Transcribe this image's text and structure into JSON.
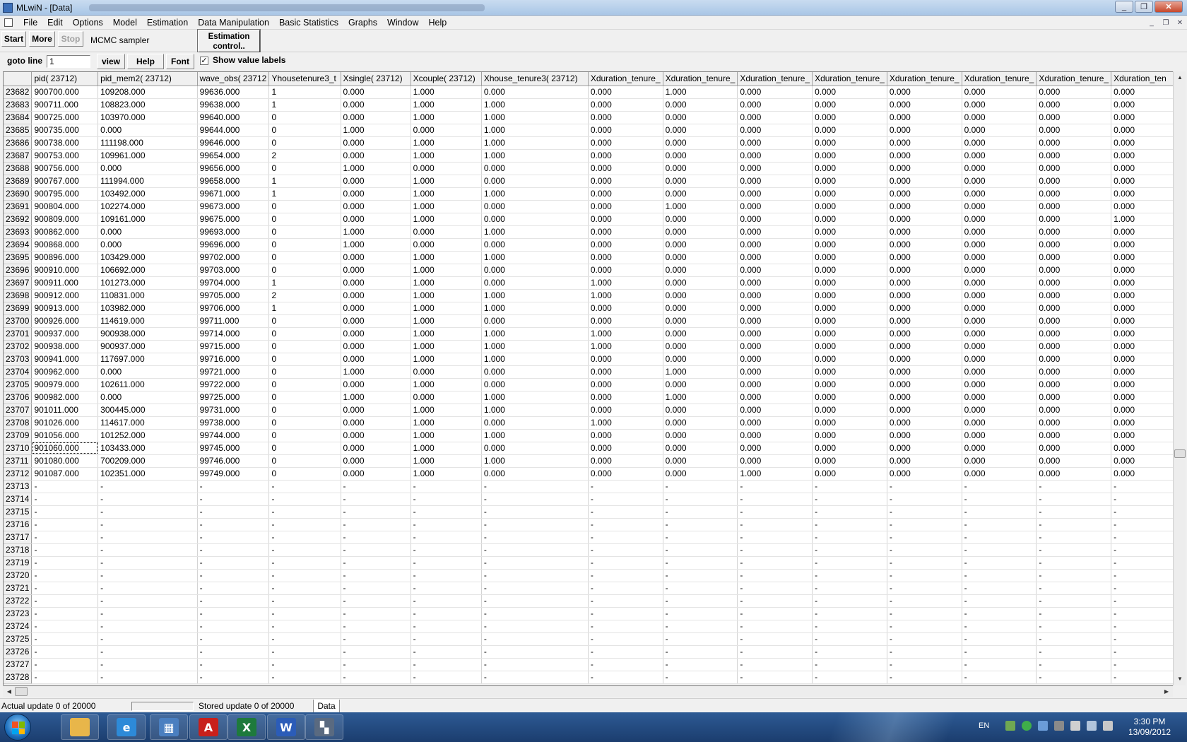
{
  "window": {
    "title": "MLwiN - [Data]",
    "controls": [
      "_",
      "❐",
      "✕"
    ]
  },
  "menu": [
    "File",
    "Edit",
    "Options",
    "Model",
    "Estimation",
    "Data Manipulation",
    "Basic Statistics",
    "Graphs",
    "Window",
    "Help"
  ],
  "toolbar": {
    "start": "Start",
    "more": "More",
    "stop": "Stop",
    "sampler_label": "MCMC sampler",
    "estimation_line1": "Estimation",
    "estimation_line2": "control.."
  },
  "data_controls": {
    "goto_label": "goto line",
    "goto_value": "1",
    "view": "view",
    "help": "Help",
    "font": "Font",
    "show_value_labels_checked": "✓",
    "show_value_labels": "Show value labels"
  },
  "grid": {
    "columns": [
      "pid( 23712)",
      "pid_mem2( 23712)",
      "wave_obs( 23712",
      "Yhousetenure3_t",
      "Xsingle( 23712)",
      "Xcouple( 23712)",
      "Xhouse_tenure3( 23712)",
      "Xduration_tenure_",
      "Xduration_tenure_",
      "Xduration_tenure_",
      "Xduration_tenure_",
      "Xduration_tenure_",
      "Xduration_tenure_",
      "Xduration_tenure_",
      "Xduration_ten"
    ],
    "rows": [
      [
        "23682",
        "900700.000",
        "109208.000",
        "99636.000",
        "1",
        "0.000",
        "1.000",
        "0.000",
        "0.000",
        "1.000",
        "0.000",
        "0.000",
        "0.000",
        "0.000",
        "0.000",
        "0.000"
      ],
      [
        "23683",
        "900711.000",
        "108823.000",
        "99638.000",
        "1",
        "0.000",
        "1.000",
        "1.000",
        "0.000",
        "0.000",
        "0.000",
        "0.000",
        "0.000",
        "0.000",
        "0.000",
        "0.000"
      ],
      [
        "23684",
        "900725.000",
        "103970.000",
        "99640.000",
        "0",
        "0.000",
        "1.000",
        "1.000",
        "0.000",
        "0.000",
        "0.000",
        "0.000",
        "0.000",
        "0.000",
        "0.000",
        "0.000"
      ],
      [
        "23685",
        "900735.000",
        "0.000",
        "99644.000",
        "0",
        "1.000",
        "0.000",
        "1.000",
        "0.000",
        "0.000",
        "0.000",
        "0.000",
        "0.000",
        "0.000",
        "0.000",
        "0.000"
      ],
      [
        "23686",
        "900738.000",
        "111198.000",
        "99646.000",
        "0",
        "0.000",
        "1.000",
        "1.000",
        "0.000",
        "0.000",
        "0.000",
        "0.000",
        "0.000",
        "0.000",
        "0.000",
        "0.000"
      ],
      [
        "23687",
        "900753.000",
        "109961.000",
        "99654.000",
        "2",
        "0.000",
        "1.000",
        "1.000",
        "0.000",
        "0.000",
        "0.000",
        "0.000",
        "0.000",
        "0.000",
        "0.000",
        "0.000"
      ],
      [
        "23688",
        "900756.000",
        "0.000",
        "99656.000",
        "0",
        "1.000",
        "0.000",
        "0.000",
        "0.000",
        "0.000",
        "0.000",
        "0.000",
        "0.000",
        "0.000",
        "0.000",
        "0.000"
      ],
      [
        "23689",
        "900767.000",
        "111994.000",
        "99658.000",
        "1",
        "0.000",
        "1.000",
        "0.000",
        "0.000",
        "0.000",
        "0.000",
        "0.000",
        "0.000",
        "0.000",
        "0.000",
        "0.000"
      ],
      [
        "23690",
        "900795.000",
        "103492.000",
        "99671.000",
        "1",
        "0.000",
        "1.000",
        "1.000",
        "0.000",
        "0.000",
        "0.000",
        "0.000",
        "0.000",
        "0.000",
        "0.000",
        "0.000"
      ],
      [
        "23691",
        "900804.000",
        "102274.000",
        "99673.000",
        "0",
        "0.000",
        "1.000",
        "0.000",
        "0.000",
        "1.000",
        "0.000",
        "0.000",
        "0.000",
        "0.000",
        "0.000",
        "0.000"
      ],
      [
        "23692",
        "900809.000",
        "109161.000",
        "99675.000",
        "0",
        "0.000",
        "1.000",
        "0.000",
        "0.000",
        "0.000",
        "0.000",
        "0.000",
        "0.000",
        "0.000",
        "0.000",
        "1.000"
      ],
      [
        "23693",
        "900862.000",
        "0.000",
        "99693.000",
        "0",
        "1.000",
        "0.000",
        "1.000",
        "0.000",
        "0.000",
        "0.000",
        "0.000",
        "0.000",
        "0.000",
        "0.000",
        "0.000"
      ],
      [
        "23694",
        "900868.000",
        "0.000",
        "99696.000",
        "0",
        "1.000",
        "0.000",
        "0.000",
        "0.000",
        "0.000",
        "0.000",
        "0.000",
        "0.000",
        "0.000",
        "0.000",
        "0.000"
      ],
      [
        "23695",
        "900896.000",
        "103429.000",
        "99702.000",
        "0",
        "0.000",
        "1.000",
        "1.000",
        "0.000",
        "0.000",
        "0.000",
        "0.000",
        "0.000",
        "0.000",
        "0.000",
        "0.000"
      ],
      [
        "23696",
        "900910.000",
        "106692.000",
        "99703.000",
        "0",
        "0.000",
        "1.000",
        "0.000",
        "0.000",
        "0.000",
        "0.000",
        "0.000",
        "0.000",
        "0.000",
        "0.000",
        "0.000"
      ],
      [
        "23697",
        "900911.000",
        "101273.000",
        "99704.000",
        "1",
        "0.000",
        "1.000",
        "0.000",
        "1.000",
        "0.000",
        "0.000",
        "0.000",
        "0.000",
        "0.000",
        "0.000",
        "0.000"
      ],
      [
        "23698",
        "900912.000",
        "110831.000",
        "99705.000",
        "2",
        "0.000",
        "1.000",
        "1.000",
        "1.000",
        "0.000",
        "0.000",
        "0.000",
        "0.000",
        "0.000",
        "0.000",
        "0.000"
      ],
      [
        "23699",
        "900913.000",
        "103982.000",
        "99706.000",
        "1",
        "0.000",
        "1.000",
        "1.000",
        "0.000",
        "0.000",
        "0.000",
        "0.000",
        "0.000",
        "0.000",
        "0.000",
        "0.000"
      ],
      [
        "23700",
        "900926.000",
        "114619.000",
        "99711.000",
        "0",
        "0.000",
        "1.000",
        "0.000",
        "0.000",
        "0.000",
        "0.000",
        "0.000",
        "0.000",
        "0.000",
        "0.000",
        "0.000"
      ],
      [
        "23701",
        "900937.000",
        "900938.000",
        "99714.000",
        "0",
        "0.000",
        "1.000",
        "1.000",
        "1.000",
        "0.000",
        "0.000",
        "0.000",
        "0.000",
        "0.000",
        "0.000",
        "0.000"
      ],
      [
        "23702",
        "900938.000",
        "900937.000",
        "99715.000",
        "0",
        "0.000",
        "1.000",
        "1.000",
        "1.000",
        "0.000",
        "0.000",
        "0.000",
        "0.000",
        "0.000",
        "0.000",
        "0.000"
      ],
      [
        "23703",
        "900941.000",
        "117697.000",
        "99716.000",
        "0",
        "0.000",
        "1.000",
        "1.000",
        "0.000",
        "0.000",
        "0.000",
        "0.000",
        "0.000",
        "0.000",
        "0.000",
        "0.000"
      ],
      [
        "23704",
        "900962.000",
        "0.000",
        "99721.000",
        "0",
        "1.000",
        "0.000",
        "0.000",
        "0.000",
        "1.000",
        "0.000",
        "0.000",
        "0.000",
        "0.000",
        "0.000",
        "0.000"
      ],
      [
        "23705",
        "900979.000",
        "102611.000",
        "99722.000",
        "0",
        "0.000",
        "1.000",
        "0.000",
        "0.000",
        "0.000",
        "0.000",
        "0.000",
        "0.000",
        "0.000",
        "0.000",
        "0.000"
      ],
      [
        "23706",
        "900982.000",
        "0.000",
        "99725.000",
        "0",
        "1.000",
        "0.000",
        "1.000",
        "0.000",
        "1.000",
        "0.000",
        "0.000",
        "0.000",
        "0.000",
        "0.000",
        "0.000"
      ],
      [
        "23707",
        "901011.000",
        "300445.000",
        "99731.000",
        "0",
        "0.000",
        "1.000",
        "1.000",
        "0.000",
        "0.000",
        "0.000",
        "0.000",
        "0.000",
        "0.000",
        "0.000",
        "0.000"
      ],
      [
        "23708",
        "901026.000",
        "114617.000",
        "99738.000",
        "0",
        "0.000",
        "1.000",
        "0.000",
        "1.000",
        "0.000",
        "0.000",
        "0.000",
        "0.000",
        "0.000",
        "0.000",
        "0.000"
      ],
      [
        "23709",
        "901056.000",
        "101252.000",
        "99744.000",
        "0",
        "0.000",
        "1.000",
        "1.000",
        "0.000",
        "0.000",
        "0.000",
        "0.000",
        "0.000",
        "0.000",
        "0.000",
        "0.000"
      ],
      [
        "23710",
        "901060.000",
        "103433.000",
        "99745.000",
        "0",
        "0.000",
        "1.000",
        "0.000",
        "0.000",
        "0.000",
        "0.000",
        "0.000",
        "0.000",
        "0.000",
        "0.000",
        "0.000"
      ],
      [
        "23711",
        "901080.000",
        "700209.000",
        "99746.000",
        "0",
        "0.000",
        "1.000",
        "1.000",
        "0.000",
        "0.000",
        "0.000",
        "0.000",
        "0.000",
        "0.000",
        "0.000",
        "0.000"
      ],
      [
        "23712",
        "901087.000",
        "102351.000",
        "99749.000",
        "0",
        "0.000",
        "1.000",
        "0.000",
        "0.000",
        "0.000",
        "1.000",
        "0.000",
        "0.000",
        "0.000",
        "0.000",
        "0.000"
      ]
    ],
    "empty_rows": [
      "23713",
      "23714",
      "23715",
      "23716",
      "23717",
      "23718",
      "23719",
      "23720",
      "23721",
      "23722",
      "23723",
      "23724",
      "23725",
      "23726",
      "23727",
      "23728"
    ],
    "empty_marker": "-",
    "selected_row": "23710"
  },
  "status": {
    "actual": "Actual update 0 of 20000",
    "progress_fraction": 0,
    "stored": "Stored update 0 of 20000",
    "tab": "Data"
  },
  "taskbar": {
    "apps": [
      {
        "name": "explorer-icon",
        "color": "#e8b64a",
        "glyph": ""
      },
      {
        "name": "internet-explorer-icon",
        "color": "#2d8ad8",
        "glyph": "e"
      },
      {
        "name": "calendar-app-icon",
        "color": "#4a7fc0",
        "glyph": "▦"
      },
      {
        "name": "acrobat-icon",
        "color": "#c8201c",
        "glyph": "A"
      },
      {
        "name": "excel-icon",
        "color": "#1e7a3c",
        "glyph": "X"
      },
      {
        "name": "word-icon",
        "color": "#2b5cb8",
        "glyph": "W"
      },
      {
        "name": "mlwin-icon",
        "color": "#5a6a80",
        "glyph": "▚"
      }
    ],
    "lang": "EN",
    "time": "3:30 PM",
    "date": "13/09/2012"
  }
}
